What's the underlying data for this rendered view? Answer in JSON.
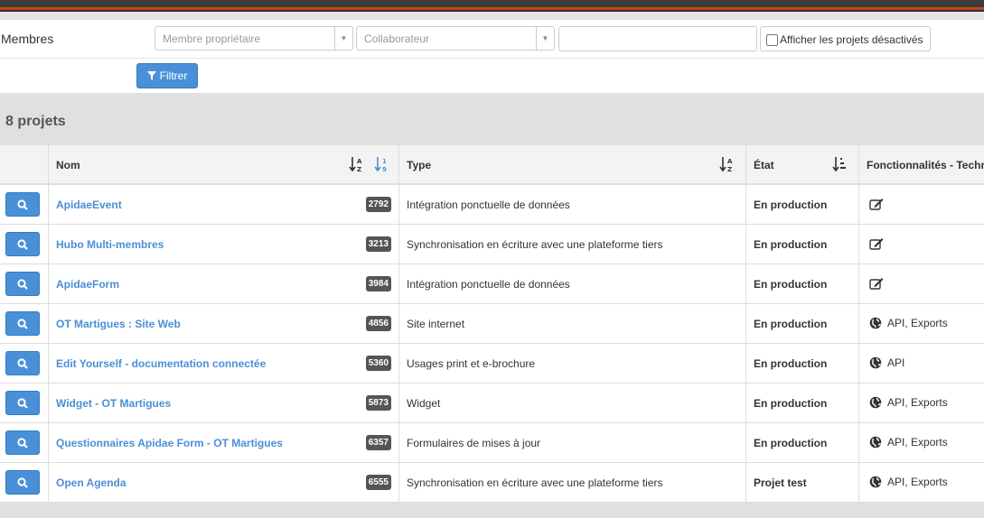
{
  "filters": {
    "membres_label": "Membres",
    "owner_placeholder": "Membre propriétaire",
    "collab_placeholder": "Collaborateur",
    "search_value": "",
    "show_disabled_label": "Afficher les projets désactivés",
    "filter_button": "Filtrer"
  },
  "summary": {
    "count_label": "8 projets"
  },
  "table": {
    "headers": {
      "nom": "Nom",
      "type": "Type",
      "etat": "État",
      "fonc": "Fonctionnalités - Techn"
    },
    "rows": [
      {
        "name": "ApidaeEvent",
        "id": "2792",
        "type": "Intégration ponctuelle de données",
        "etat": "En production",
        "fonc_icon": "edit-icon",
        "fonc": ""
      },
      {
        "name": "Hubo Multi-membres",
        "id": "3213",
        "type": "Synchronisation en écriture avec une plateforme tiers",
        "etat": "En production",
        "fonc_icon": "edit-icon",
        "fonc": ""
      },
      {
        "name": "ApidaeForm",
        "id": "3984",
        "type": "Intégration ponctuelle de données",
        "etat": "En production",
        "fonc_icon": "edit-icon",
        "fonc": ""
      },
      {
        "name": "OT Martigues : Site Web",
        "id": "4856",
        "type": "Site internet",
        "etat": "En production",
        "fonc_icon": "globe-icon",
        "fonc": "API, Exports"
      },
      {
        "name": "Edit Yourself - documentation connectée",
        "id": "5360",
        "type": "Usages print et e-brochure",
        "etat": "En production",
        "fonc_icon": "globe-icon",
        "fonc": "API"
      },
      {
        "name": "Widget - OT Martigues",
        "id": "5873",
        "type": "Widget",
        "etat": "En production",
        "fonc_icon": "globe-icon",
        "fonc": "API, Exports"
      },
      {
        "name": "Questionnaires Apidae Form - OT Martigues",
        "id": "6357",
        "type": "Formulaires de mises à jour",
        "etat": "En production",
        "fonc_icon": "globe-icon",
        "fonc": "API, Exports"
      },
      {
        "name": "Open Agenda",
        "id": "6555",
        "type": "Synchronisation en écriture avec une plateforme tiers",
        "etat": "Projet test",
        "fonc_icon": "globe-icon",
        "fonc": "API, Exports"
      }
    ]
  },
  "colors": {
    "accent": "#4a90d9",
    "link": "#4a8fd6",
    "badge": "#555555",
    "brand_stripe": "#c8441b"
  }
}
